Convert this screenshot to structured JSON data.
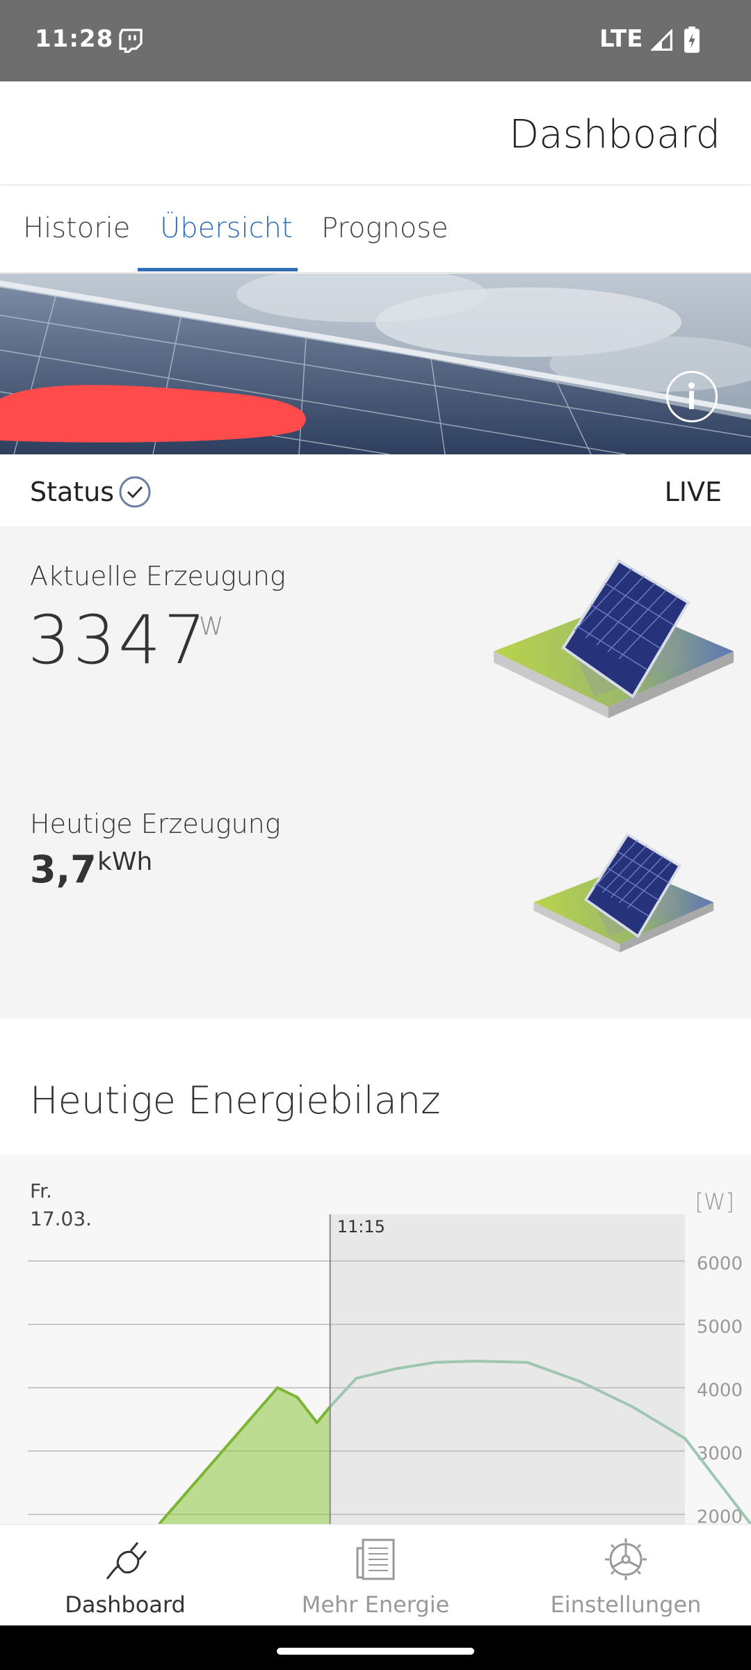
{
  "status_bar": {
    "time": "11:28",
    "network": "LTE",
    "icons": [
      "twitch-icon",
      "signal-icon",
      "battery-charging-icon"
    ]
  },
  "app_bar": {
    "title": "Dashboard"
  },
  "tabs": [
    {
      "label": "Historie",
      "active": false
    },
    {
      "label": "Übersicht",
      "active": true
    },
    {
      "label": "Prognose",
      "active": false
    }
  ],
  "banner": {
    "info_icon": "info-icon"
  },
  "status": {
    "label": "Status",
    "state_icon": "check-circle-icon",
    "live_label": "LIVE"
  },
  "current_production": {
    "label": "Aktuelle Erzeugung",
    "value": "3347",
    "unit": "W"
  },
  "today_production": {
    "label": "Heutige Erzeugung",
    "value": "3,7",
    "unit": "kWh"
  },
  "energy_balance": {
    "title": "Heutige Energiebilanz",
    "day": "Fr.",
    "date": "17.03.",
    "unit": "[W]"
  },
  "chart_data": {
    "type": "area",
    "cursor_label": "11:15",
    "y_tick_labels": [
      "6000",
      "5000",
      "4000",
      "3000",
      "2000"
    ],
    "y_ticks": [
      6000,
      5000,
      4000,
      3000,
      2000
    ],
    "ylim": [
      1850,
      6300
    ],
    "colors": {
      "actual": "#8cc63f",
      "forecast": "#9ec7b2",
      "future_bg": "#e8e8e8"
    },
    "series": [
      {
        "x": [
          0.2,
          0.38,
          0.41,
          0.44,
          0.46
        ],
        "values": [
          1850,
          4000,
          3850,
          3450,
          3700
        ]
      },
      {
        "x": [
          0.46,
          0.5,
          0.56,
          0.62,
          0.68,
          0.76,
          0.84,
          0.92,
          1.0,
          1.1
        ],
        "values": [
          3700,
          4150,
          4300,
          4400,
          4420,
          4400,
          4100,
          3700,
          3200,
          1850
        ]
      }
    ]
  },
  "bottom_nav": [
    {
      "label": "Dashboard",
      "icon": "plug-icon",
      "active": true
    },
    {
      "label": "Mehr Energie",
      "icon": "newspaper-icon",
      "active": false
    },
    {
      "label": "Einstellungen",
      "icon": "settings-wheel-icon",
      "active": false
    }
  ]
}
